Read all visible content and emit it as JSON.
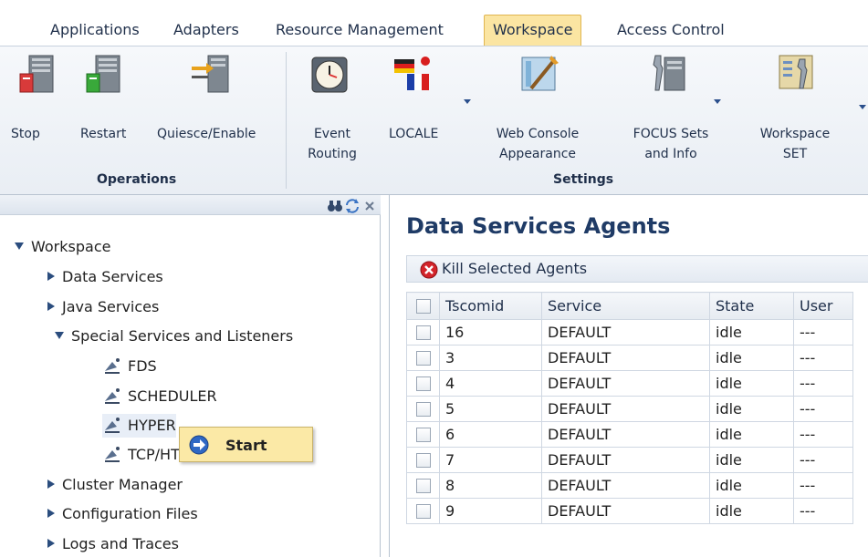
{
  "tabs": [
    {
      "label": "Applications",
      "active": false
    },
    {
      "label": "Adapters",
      "active": false
    },
    {
      "label": "Resource Management",
      "active": false
    },
    {
      "label": "Workspace",
      "active": true
    },
    {
      "label": "Access Control",
      "active": false
    }
  ],
  "ribbon": {
    "operations": {
      "group_label": "Operations",
      "buttons": [
        {
          "label": "Stop",
          "icon": "server-stop-icon"
        },
        {
          "label": "Restart",
          "icon": "server-restart-icon"
        },
        {
          "label": "Quiesce/Enable",
          "icon": "server-quiesce-icon"
        }
      ]
    },
    "settings": {
      "group_label": "Settings",
      "buttons": [
        {
          "label1": "Event",
          "label2": "Routing",
          "icon": "clock-icon"
        },
        {
          "label1": "LOCALE",
          "label2": "",
          "icon": "flags-icon"
        },
        {
          "label1": "Web Console",
          "label2": "Appearance",
          "icon": "paint-icon"
        },
        {
          "label1": "FOCUS Sets",
          "label2": "and Info",
          "icon": "tools-server-icon"
        },
        {
          "label1": "Workspace",
          "label2": "SET",
          "icon": "workspace-set-icon"
        }
      ]
    }
  },
  "tree": {
    "root": "Workspace",
    "items": [
      {
        "label": "Data Services"
      },
      {
        "label": "Java Services"
      },
      {
        "label": "Special Services and Listeners"
      },
      {
        "label": "FDS"
      },
      {
        "label": "SCHEDULER"
      },
      {
        "label": "HYPER"
      },
      {
        "label": "TCP/HTTP"
      },
      {
        "label": "Cluster Manager"
      },
      {
        "label": "Configuration Files"
      },
      {
        "label": "Logs and Traces"
      }
    ]
  },
  "context_menu": {
    "label": "Start"
  },
  "main": {
    "title": "Data Services Agents",
    "kill_label": "Kill Selected Agents",
    "columns": [
      "Tscomid",
      "Service",
      "State",
      "User"
    ],
    "rows": [
      [
        "16",
        "DEFAULT",
        "idle",
        "---"
      ],
      [
        "3",
        "DEFAULT",
        "idle",
        "---"
      ],
      [
        "4",
        "DEFAULT",
        "idle",
        "---"
      ],
      [
        "5",
        "DEFAULT",
        "idle",
        "---"
      ],
      [
        "6",
        "DEFAULT",
        "idle",
        "---"
      ],
      [
        "7",
        "DEFAULT",
        "idle",
        "---"
      ],
      [
        "8",
        "DEFAULT",
        "idle",
        "---"
      ],
      [
        "9",
        "DEFAULT",
        "idle",
        "---"
      ]
    ]
  },
  "colors": {
    "active_tab": "#fbe5a2",
    "title": "#1f3b66",
    "context_menu": "#fbe9a6",
    "kill_red": "#d3242a"
  }
}
